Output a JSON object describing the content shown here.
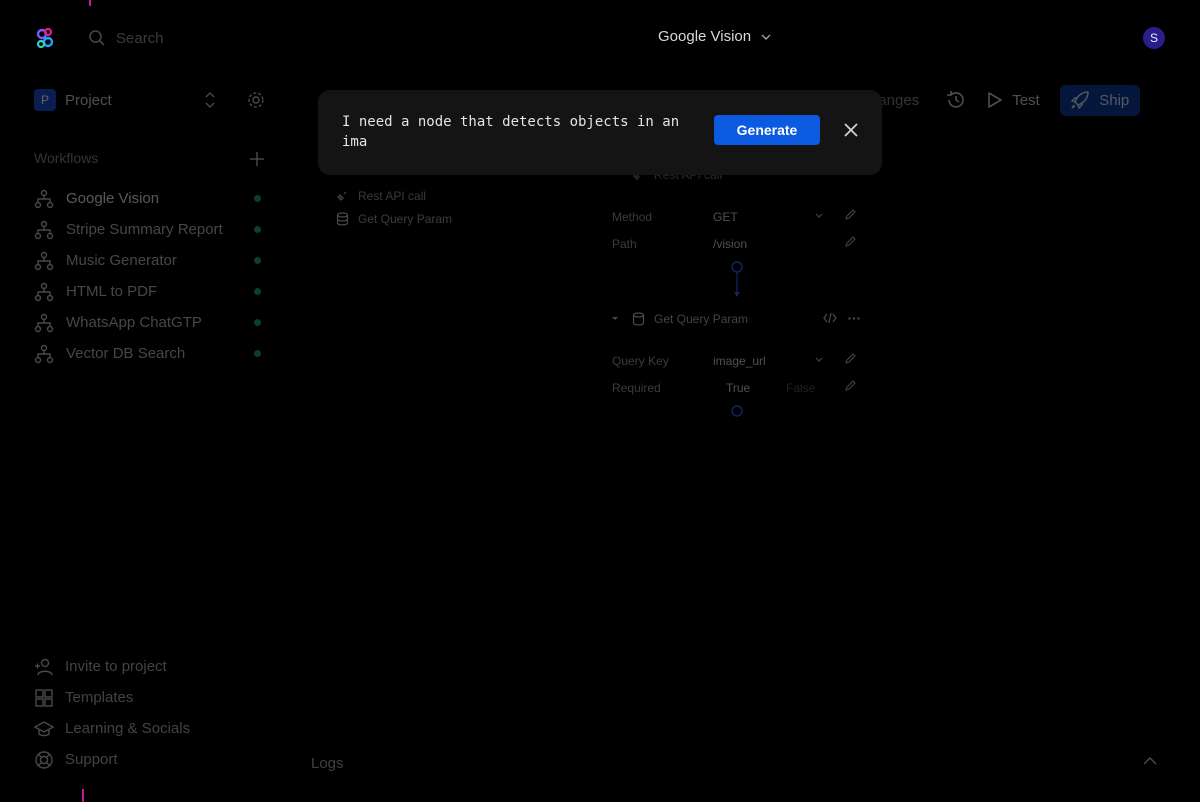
{
  "header": {
    "search_placeholder": "Search",
    "workflow_selector": "Google Vision",
    "avatar_initial": "S",
    "logo_icon": "app-logo-icon"
  },
  "project": {
    "badge": "P",
    "label": "Project"
  },
  "workflows": {
    "title": "Workflows",
    "items": [
      {
        "label": "Google Vision"
      },
      {
        "label": "Stripe Summary Report"
      },
      {
        "label": "Music Generator"
      },
      {
        "label": "HTML to PDF"
      },
      {
        "label": "WhatsApp ChatGTP"
      },
      {
        "label": "Vector DB Search"
      }
    ],
    "status_color": "#1ea672"
  },
  "bottom_nav": {
    "invite": "Invite to project",
    "templates": "Templates",
    "learning": "Learning & Socials",
    "support": "Support"
  },
  "toolbar": {
    "changes": "nanges",
    "test": "Test",
    "ship": "Ship"
  },
  "node_list": {
    "items": [
      "Rest API call",
      "Get Query Param"
    ]
  },
  "canvas": {
    "node1": {
      "title": "Rest API call",
      "method_label": "Method",
      "method_value": "GET",
      "path_label": "Path",
      "path_value": "/vision"
    },
    "node2": {
      "title": "Get Query Param",
      "query_key_label": "Query Key",
      "query_key_value": "image_url",
      "required_label": "Required",
      "required_true": "True",
      "required_false": "False"
    }
  },
  "dialog": {
    "prompt": "I need a node that detects objects in an ima",
    "generate": "Generate"
  },
  "logs": {
    "label": "Logs"
  },
  "colors": {
    "accent": "#0b5ae0",
    "ship_bg": "#0d3a9e",
    "project_badge": "#1f4fd8",
    "avatar": "#2a1e8a",
    "edge_marker": "#c2189b"
  }
}
